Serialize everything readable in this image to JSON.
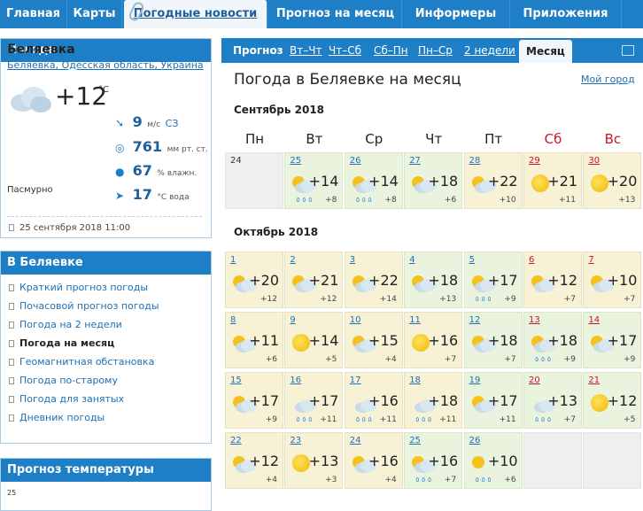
{
  "nav": {
    "items": [
      "Главная",
      "Карты",
      "Погодные новости",
      "Прогноз на месяц",
      "Информеры",
      "Приложения"
    ],
    "active": 2
  },
  "weather": {
    "panel_title": "Погода",
    "city": "Беляевка",
    "region": [
      "Беляевка",
      "Одесская область",
      "Украина"
    ],
    "temp": "+12",
    "temp_unit": "°C",
    "condition": "Пасмурно",
    "wind": {
      "value": "9",
      "unit": "м/с",
      "dir": "СЗ"
    },
    "pressure": {
      "value": "761",
      "unit": "мм рт. ст."
    },
    "humidity": {
      "value": "67",
      "unit": "% влажн."
    },
    "water": {
      "value": "17",
      "unit": "°C вода"
    },
    "updated": "25 сентября 2018 11:00"
  },
  "local_menu": {
    "title": "В Беляевке",
    "items": [
      "Краткий прогноз погоды",
      "Почасовой прогноз погоды",
      "Погода на 2 недели",
      "Погода на месяц",
      "Геомагнитная обстановка",
      "Погода по-старому",
      "Погода для занятых",
      "Дневник погоды"
    ],
    "current": 3
  },
  "temp_forecast": {
    "title": "Прогноз температуры",
    "scale_label": "25"
  },
  "tabs": {
    "items": [
      "Прогноз",
      "Вт–Чт",
      "Чт–Сб",
      "Сб–Пн",
      "Пн–Ср",
      "2 недели",
      "Месяц"
    ],
    "active": 6
  },
  "calendar": {
    "title": "Погода в Беляевке на месяц",
    "my_city": "Мой город",
    "weekdays": [
      "Пн",
      "Вт",
      "Ср",
      "Чт",
      "Пт",
      "Сб",
      "Вс"
    ],
    "months": [
      {
        "name": "Сентябрь 2018",
        "rows": [
          [
            {
              "d": "24",
              "empty": true
            },
            {
              "d": "25",
              "t": "+14",
              "n": "+8",
              "icon": "cloud-sun-rain-icon"
            },
            {
              "d": "26",
              "t": "+14",
              "n": "+8",
              "icon": "cloud-sun-rain-icon"
            },
            {
              "d": "27",
              "t": "+18",
              "n": "+6",
              "icon": "cloud-sun-icon"
            },
            {
              "d": "28",
              "t": "+22",
              "n": "+10",
              "icon": "cloud-sun-icon"
            },
            {
              "d": "29",
              "t": "+21",
              "n": "+11",
              "icon": "sun-icon"
            },
            {
              "d": "30",
              "t": "+20",
              "n": "+13",
              "icon": "sun-icon"
            }
          ]
        ]
      },
      {
        "name": "Октябрь 2018",
        "rows": [
          [
            {
              "d": "1",
              "t": "+20",
              "n": "+12",
              "icon": "cloud-sun-icon"
            },
            {
              "d": "2",
              "t": "+21",
              "n": "+12",
              "icon": "cloud-sun-icon"
            },
            {
              "d": "3",
              "t": "+22",
              "n": "+14",
              "icon": "cloud-sun-icon"
            },
            {
              "d": "4",
              "t": "+18",
              "n": "+13",
              "icon": "cloud-sun-icon"
            },
            {
              "d": "5",
              "t": "+17",
              "n": "+9",
              "icon": "cloud-sun-rain-icon"
            },
            {
              "d": "6",
              "t": "+12",
              "n": "+7",
              "icon": "cloud-sun-icon"
            },
            {
              "d": "7",
              "t": "+10",
              "n": "+7",
              "icon": "cloud-sun-icon"
            }
          ],
          [
            {
              "d": "8",
              "t": "+11",
              "n": "+6",
              "icon": "cloud-sun-icon"
            },
            {
              "d": "9",
              "t": "+14",
              "n": "+5",
              "icon": "sun-icon"
            },
            {
              "d": "10",
              "t": "+15",
              "n": "+4",
              "icon": "cloud-sun-icon"
            },
            {
              "d": "11",
              "t": "+16",
              "n": "+7",
              "icon": "sun-icon"
            },
            {
              "d": "12",
              "t": "+18",
              "n": "+7",
              "icon": "cloud-sun-icon"
            },
            {
              "d": "13",
              "t": "+18",
              "n": "+9",
              "icon": "cloud-sun-rain-icon"
            },
            {
              "d": "14",
              "t": "+17",
              "n": "+9",
              "icon": "cloud-sun-icon"
            }
          ],
          [
            {
              "d": "15",
              "t": "+17",
              "n": "+9",
              "icon": "cloud-sun-icon"
            },
            {
              "d": "16",
              "t": "+17",
              "n": "+11",
              "icon": "cloud-rain-icon"
            },
            {
              "d": "17",
              "t": "+16",
              "n": "+11",
              "icon": "cloud-rain-icon"
            },
            {
              "d": "18",
              "t": "+18",
              "n": "+11",
              "icon": "cloud-rain-icon"
            },
            {
              "d": "19",
              "t": "+17",
              "n": "+11",
              "icon": "cloud-sun-icon"
            },
            {
              "d": "20",
              "t": "+13",
              "n": "+7",
              "icon": "cloud-rain-icon"
            },
            {
              "d": "21",
              "t": "+12",
              "n": "+5",
              "icon": "sun-icon"
            }
          ],
          [
            {
              "d": "22",
              "t": "+12",
              "n": "+4",
              "icon": "cloud-sun-icon"
            },
            {
              "d": "23",
              "t": "+13",
              "n": "+3",
              "icon": "sun-icon"
            },
            {
              "d": "24",
              "t": "+16",
              "n": "+4",
              "icon": "cloud-sun-icon"
            },
            {
              "d": "25",
              "t": "+16",
              "n": "+7",
              "icon": "cloud-sun-rain-icon"
            },
            {
              "d": "26",
              "t": "+10",
              "n": "+6",
              "icon": "sun-rain-icon"
            },
            {
              "d": "",
              "empty": true
            },
            {
              "d": "",
              "empty": true
            }
          ]
        ]
      }
    ]
  }
}
